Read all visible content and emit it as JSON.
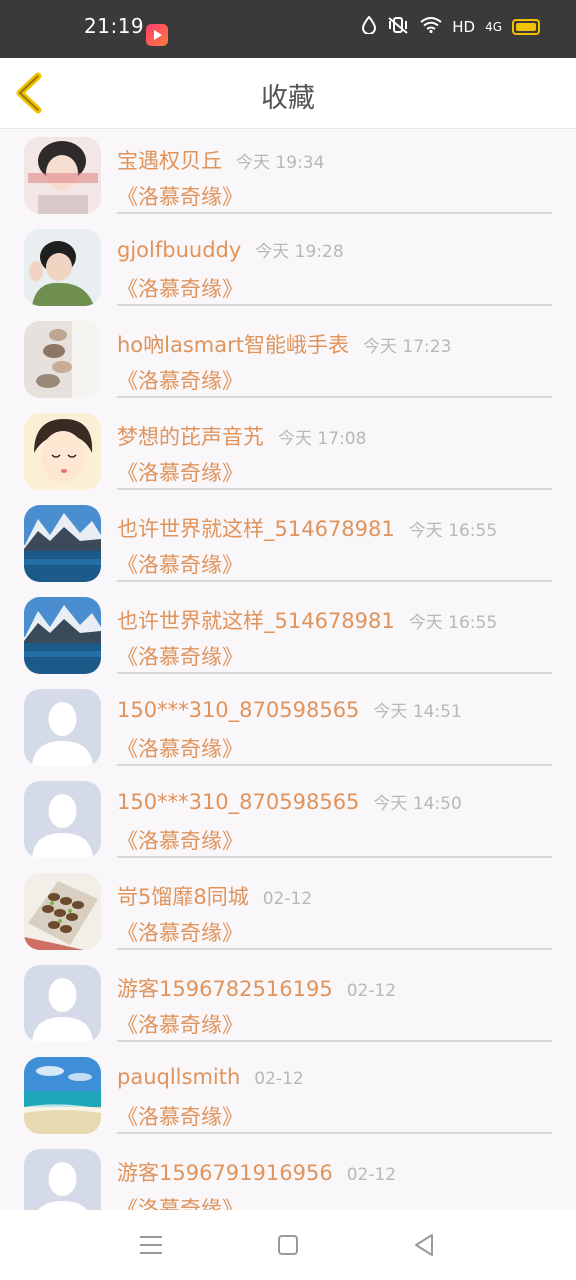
{
  "status_bar": {
    "time": "21:19",
    "network": "HD",
    "signal": "4G",
    "icons": [
      "app-icon",
      "water-drop-icon",
      "vibrate-icon",
      "wifi-icon",
      "battery-icon"
    ]
  },
  "header": {
    "title": "收藏",
    "back_icon": "chevron-left-icon",
    "back_color": "#f2c200"
  },
  "colors": {
    "accent_text": "#e0935a",
    "time_text": "#b8b8b8"
  },
  "items": [
    {
      "name": "宝遇权贝丘",
      "time": "今天 19:34",
      "book": "《洛慕奇缘》",
      "avatar": "photo-boy"
    },
    {
      "name": "gjolfbuuddy",
      "time": "今天 19:28",
      "book": "《洛慕奇缘》",
      "avatar": "photo-girl"
    },
    {
      "name": "ho吶lasmart智能峨手表",
      "time": "今天 17:23",
      "book": "《洛慕奇缘》",
      "avatar": "photo-stones"
    },
    {
      "name": "梦想的芘声音艽",
      "time": "今天 17:08",
      "book": "《洛慕奇缘》",
      "avatar": "cartoon-face"
    },
    {
      "name": "也许世界就这样_514678981",
      "time": "今天 16:55",
      "book": "《洛慕奇缘》",
      "avatar": "photo-lake"
    },
    {
      "name": "也许世界就这样_514678981",
      "time": "今天 16:55",
      "book": "《洛慕奇缘》",
      "avatar": "photo-lake"
    },
    {
      "name": "150***310_870598565",
      "time": "今天 14:51",
      "book": "《洛慕奇缘》",
      "avatar": "default-user"
    },
    {
      "name": "150***310_870598565",
      "time": "今天 14:50",
      "book": "《洛慕奇缘》",
      "avatar": "default-user"
    },
    {
      "name": "岢5馏靡8同城",
      "time": "02-12",
      "book": "《洛慕奇缘》",
      "avatar": "photo-food"
    },
    {
      "name": "游客1596782516195",
      "time": "02-12",
      "book": "《洛慕奇缘》",
      "avatar": "default-user"
    },
    {
      "name": "pauqllsmith",
      "time": "02-12",
      "book": "《洛慕奇缘》",
      "avatar": "photo-beach"
    },
    {
      "name": "游客1596791916956",
      "time": "02-12",
      "book": "《洛慕奇缘》",
      "avatar": "default-user"
    }
  ],
  "nav_bar": {
    "icons": [
      "menu-icon",
      "home-icon",
      "back-triangle-icon"
    ]
  }
}
